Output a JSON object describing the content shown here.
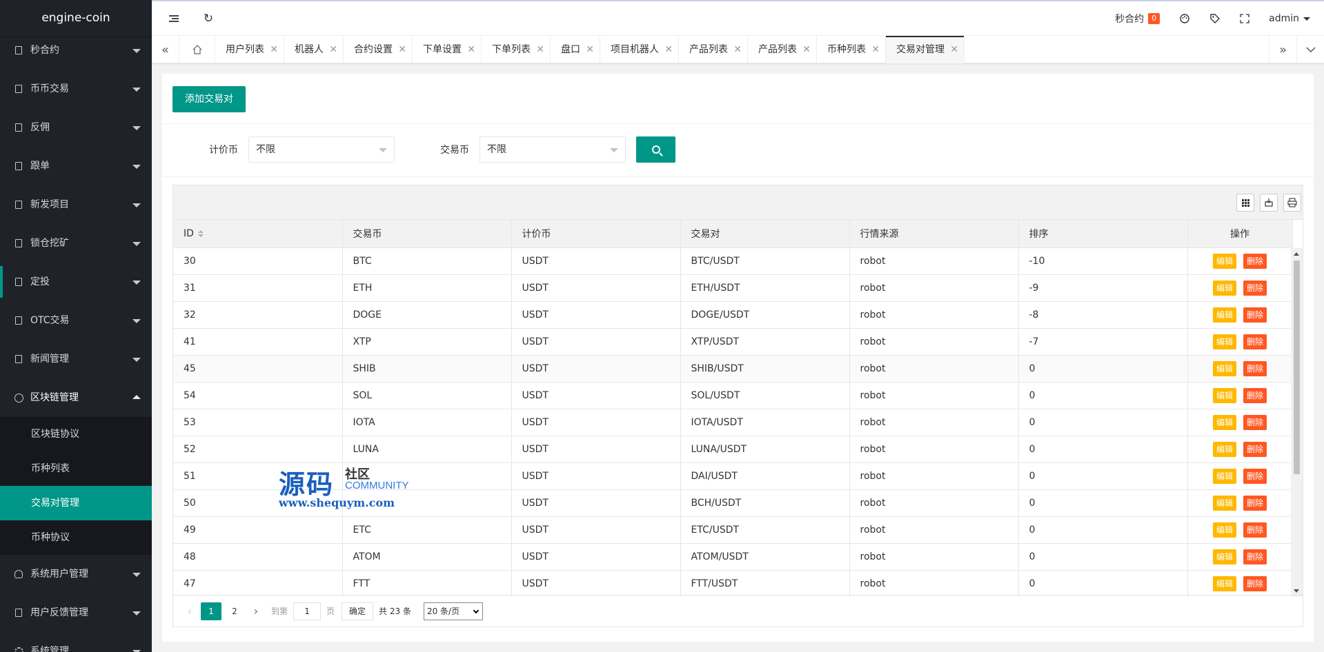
{
  "app": {
    "title": "engine-coin"
  },
  "sidebar": {
    "items": [
      {
        "label": "秒合约"
      },
      {
        "label": "币币交易"
      },
      {
        "label": "反佣"
      },
      {
        "label": "跟单"
      },
      {
        "label": "新发项目"
      },
      {
        "label": "锁仓挖矿"
      },
      {
        "label": "定投"
      },
      {
        "label": "OTC交易"
      },
      {
        "label": "新闻管理"
      },
      {
        "label": "区块链管理"
      },
      {
        "label": "系统用户管理"
      },
      {
        "label": "用户反馈管理"
      },
      {
        "label": "系统管理"
      }
    ],
    "submenu": [
      {
        "label": "区块链协议"
      },
      {
        "label": "币种列表"
      },
      {
        "label": "交易对管理"
      },
      {
        "label": "币种协议"
      }
    ]
  },
  "header": {
    "notice_label": "秒合约",
    "notice_count": "0",
    "user": "admin"
  },
  "tabs": [
    {
      "label": "用户列表"
    },
    {
      "label": "机器人"
    },
    {
      "label": "合约设置"
    },
    {
      "label": "下单设置"
    },
    {
      "label": "下单列表"
    },
    {
      "label": "盘口"
    },
    {
      "label": "项目机器人"
    },
    {
      "label": "产品列表"
    },
    {
      "label": "产品列表"
    },
    {
      "label": "币种列表"
    },
    {
      "label": "交易对管理"
    }
  ],
  "main": {
    "add_button": "添加交易对",
    "filter": {
      "quote_label": "计价币",
      "quote_value": "不限",
      "trade_label": "交易币",
      "trade_value": "不限"
    },
    "table": {
      "columns": [
        "ID",
        "交易币",
        "计价币",
        "交易对",
        "行情来源",
        "排序",
        "操作"
      ],
      "edit_label": "编辑",
      "delete_label": "删除",
      "rows": [
        {
          "id": "30",
          "coin": "BTC",
          "quote": "USDT",
          "pair": "BTC/USDT",
          "source": "robot",
          "sort": "-10"
        },
        {
          "id": "31",
          "coin": "ETH",
          "quote": "USDT",
          "pair": "ETH/USDT",
          "source": "robot",
          "sort": "-9"
        },
        {
          "id": "32",
          "coin": "DOGE",
          "quote": "USDT",
          "pair": "DOGE/USDT",
          "source": "robot",
          "sort": "-8"
        },
        {
          "id": "41",
          "coin": "XTP",
          "quote": "USDT",
          "pair": "XTP/USDT",
          "source": "robot",
          "sort": "-7"
        },
        {
          "id": "45",
          "coin": "SHIB",
          "quote": "USDT",
          "pair": "SHIB/USDT",
          "source": "robot",
          "sort": "0"
        },
        {
          "id": "54",
          "coin": "SOL",
          "quote": "USDT",
          "pair": "SOL/USDT",
          "source": "robot",
          "sort": "0"
        },
        {
          "id": "53",
          "coin": "IOTA",
          "quote": "USDT",
          "pair": "IOTA/USDT",
          "source": "robot",
          "sort": "0"
        },
        {
          "id": "52",
          "coin": "LUNA",
          "quote": "USDT",
          "pair": "LUNA/USDT",
          "source": "robot",
          "sort": "0"
        },
        {
          "id": "51",
          "coin": "",
          "quote": "USDT",
          "pair": "DAI/USDT",
          "source": "robot",
          "sort": "0"
        },
        {
          "id": "50",
          "coin": "",
          "quote": "USDT",
          "pair": "BCH/USDT",
          "source": "robot",
          "sort": "0"
        },
        {
          "id": "49",
          "coin": "ETC",
          "quote": "USDT",
          "pair": "ETC/USDT",
          "source": "robot",
          "sort": "0"
        },
        {
          "id": "48",
          "coin": "ATOM",
          "quote": "USDT",
          "pair": "ATOM/USDT",
          "source": "robot",
          "sort": "0"
        },
        {
          "id": "47",
          "coin": "FTT",
          "quote": "USDT",
          "pair": "FTT/USDT",
          "source": "robot",
          "sort": "0"
        }
      ]
    },
    "pager": {
      "page1": "1",
      "page2": "2",
      "goto_label": "到第",
      "page_input": "1",
      "page_unit": "页",
      "confirm": "确定",
      "total": "共 23 条",
      "page_size": "20 条/页"
    }
  },
  "watermark": {
    "big": "源码",
    "small": "社区",
    "community": "COMMUNITY",
    "url": "www.shequym.com"
  },
  "colors": {
    "accent": "#009688",
    "sidebar": "#20222a",
    "edit": "#ffb800",
    "delete": "#ff5722"
  }
}
